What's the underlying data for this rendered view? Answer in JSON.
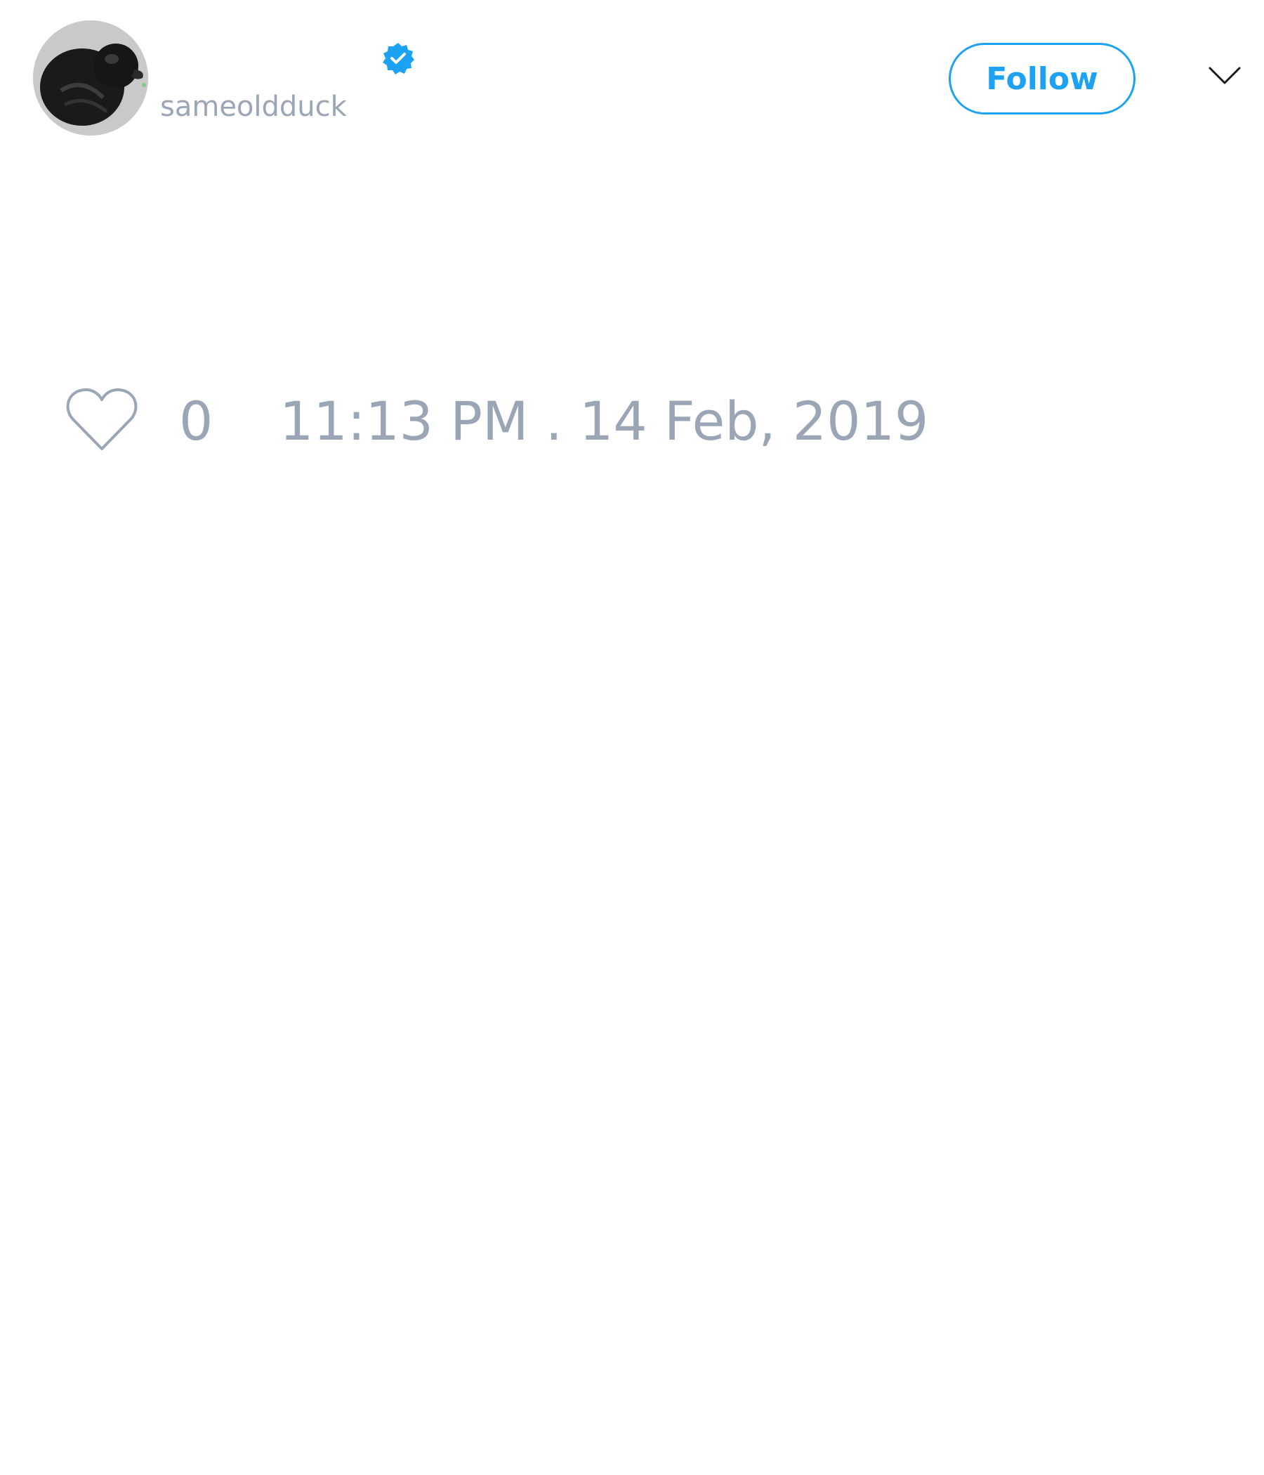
{
  "tweet": {
    "author": {
      "handle": "sameoldduck",
      "verified": true,
      "avatar_icon": "black-rubber-duck-avatar"
    },
    "follow_label": "Follow",
    "menu_icon": "chevron-down-icon",
    "likes": {
      "icon": "heart-icon",
      "count": "0"
    },
    "timestamp": "11:13 PM . 14 Feb, 2019"
  },
  "colors": {
    "accent": "#1da1f2",
    "muted_text": "#9aa6b6",
    "background": "#ffffff"
  }
}
